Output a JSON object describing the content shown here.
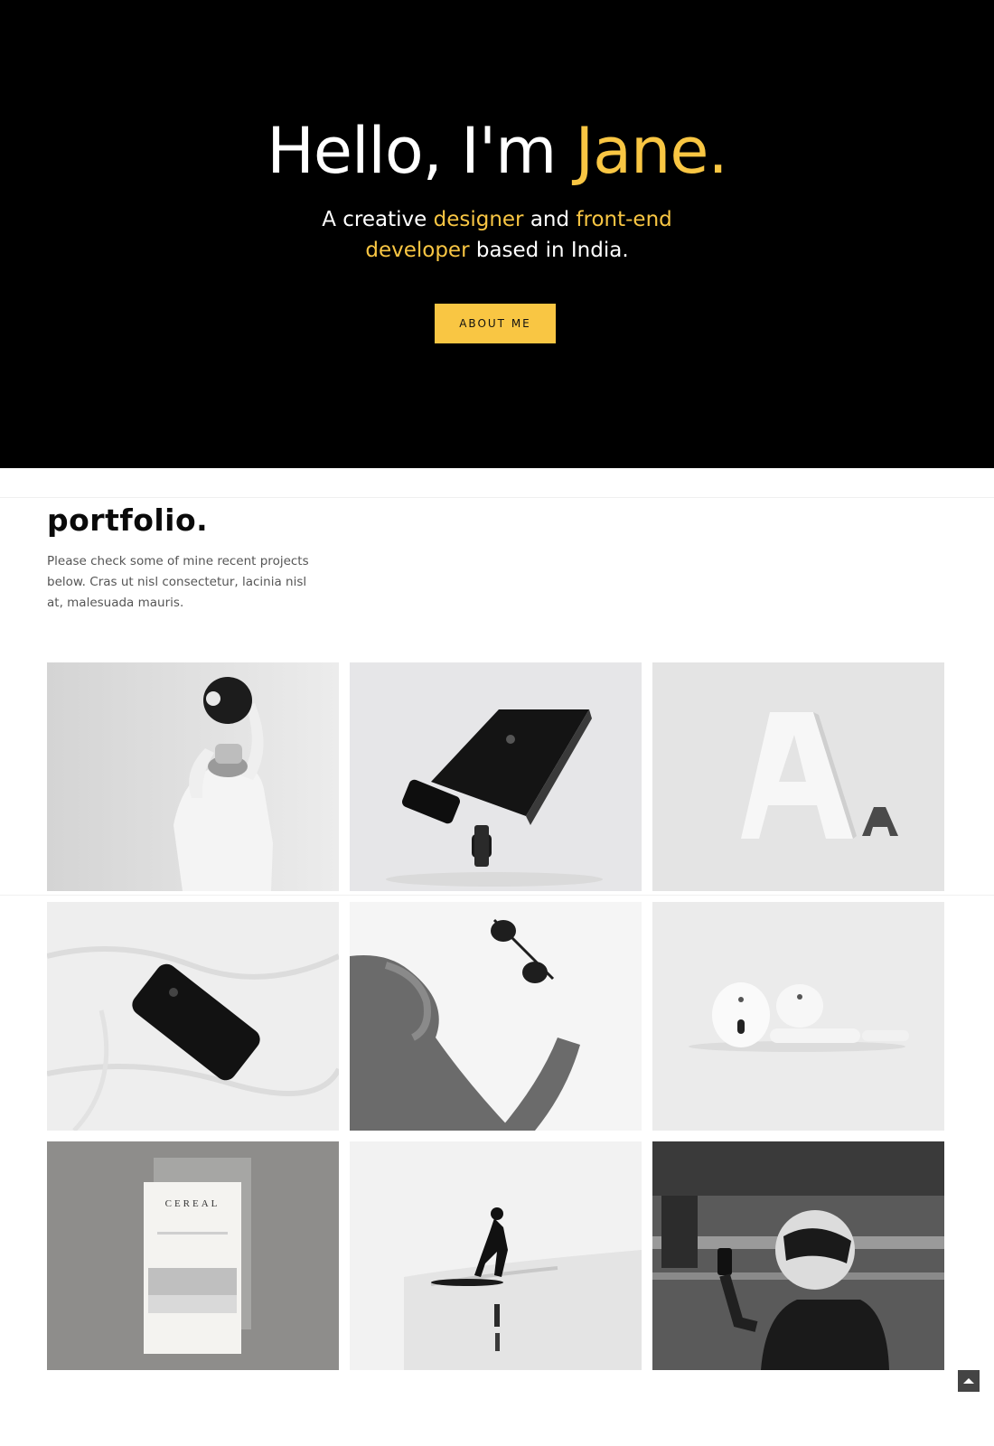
{
  "hero": {
    "title_pre": "Hello, I'm ",
    "title_name": "Jane.",
    "sub_part1": "A creative ",
    "sub_accent1": "designer",
    "sub_part2": " and ",
    "sub_accent2": "front-end",
    "sub_accent3": "developer",
    "sub_part3": " based in India.",
    "button_label": "ABOUT ME"
  },
  "portfolio": {
    "title": "portfolio.",
    "description": "Please check some of mine recent projects below. Cras ut nisl consectetur, lacinia nisl at, malesuada mauris.",
    "items": [
      {
        "subject": "person-with-hat"
      },
      {
        "subject": "laptop-phone-watch"
      },
      {
        "subject": "letters-aa"
      },
      {
        "subject": "phone-on-sheet"
      },
      {
        "subject": "sweater-sunglasses"
      },
      {
        "subject": "earbuds"
      },
      {
        "subject": "cereal-magazine",
        "text": "CEREAL"
      },
      {
        "subject": "surfer"
      },
      {
        "subject": "helmet-rider"
      }
    ]
  },
  "colors": {
    "accent": "#f9c643",
    "hero_bg": "#000000"
  }
}
